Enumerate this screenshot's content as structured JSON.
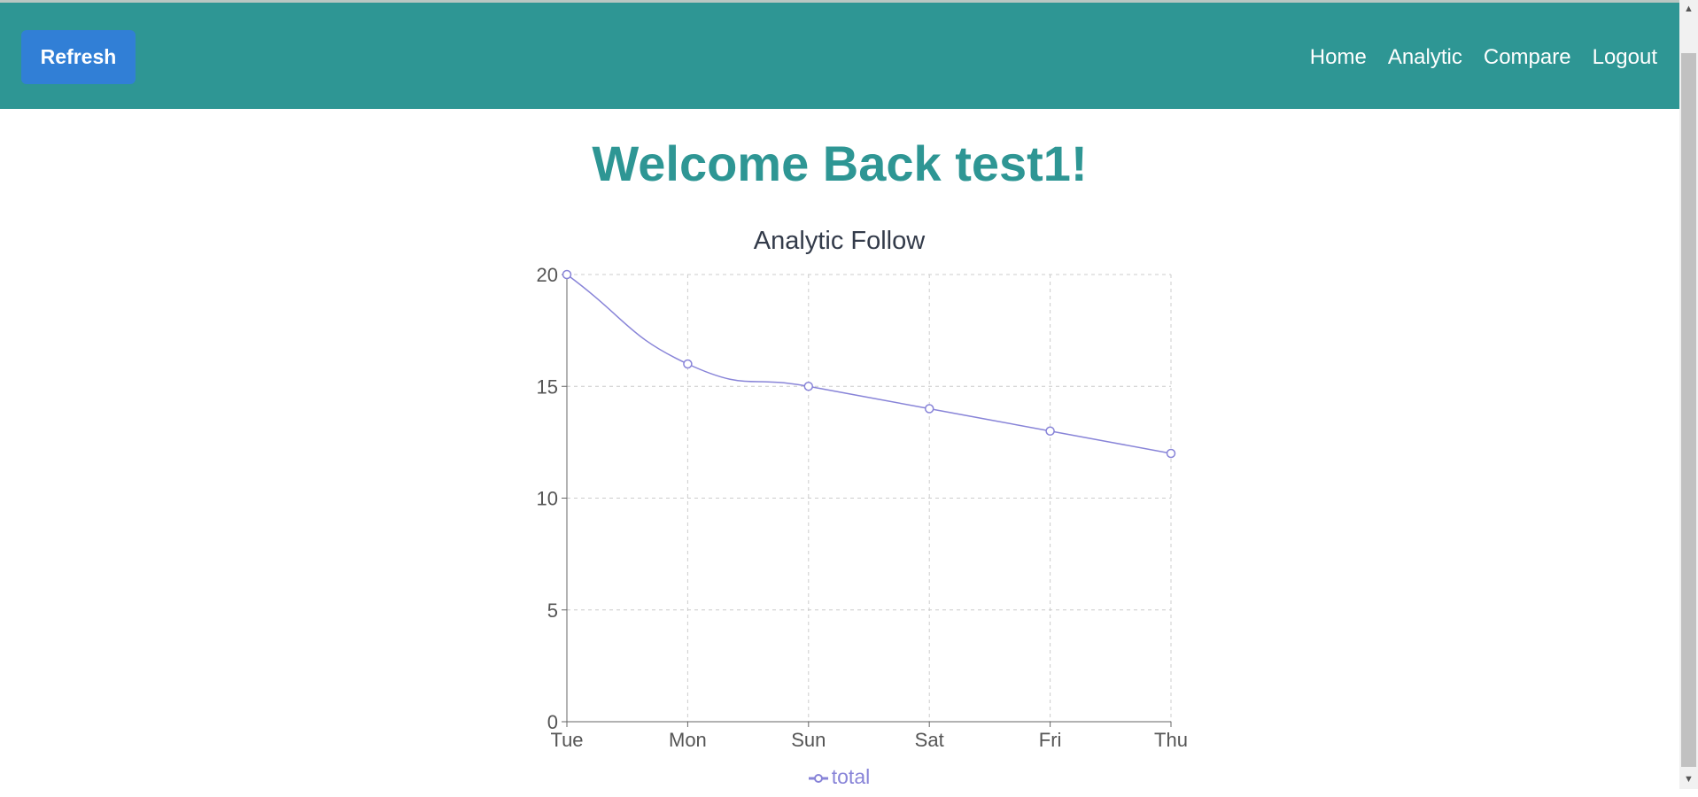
{
  "navbar": {
    "refresh_label": "Refresh",
    "links": [
      "Home",
      "Analytic",
      "Compare",
      "Logout"
    ],
    "bg_color": "#2e9694",
    "button_color": "#317fd6"
  },
  "page": {
    "welcome": "Welcome Back test1!"
  },
  "chart_data": {
    "type": "line",
    "title": "Analytic Follow",
    "categories": [
      "Tue",
      "Mon",
      "Sun",
      "Sat",
      "Fri",
      "Thu"
    ],
    "series": [
      {
        "name": "total",
        "values": [
          20,
          16,
          15,
          14,
          13,
          12
        ],
        "color": "#8884d8"
      }
    ],
    "ylim": [
      0,
      20
    ],
    "yticks": [
      0,
      5,
      10,
      15,
      20
    ],
    "grid": true,
    "legend": "bottom",
    "xlabel": "",
    "ylabel": ""
  }
}
